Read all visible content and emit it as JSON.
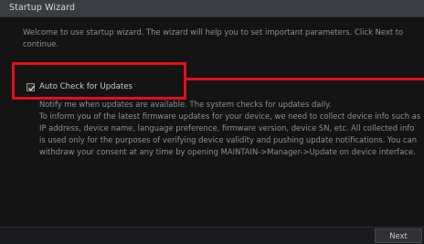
{
  "window": {
    "title": "Startup Wizard"
  },
  "intro": {
    "text": "Welcome to use startup wizard. The wizard will help you to set important parameters. Click Next to continue."
  },
  "auto_check": {
    "label": "Auto Check for Updates",
    "checked": true
  },
  "description": {
    "line1": "Notify me when updates are available. The system checks for updates daily.",
    "line2": "To inform you of the latest firmware updates for your device, we need to collect device info such as IP address, device name, language preference, firmware version, device SN, etc. All collected info is used only for the purposes of verifying device validity and pushing update notifications. You can withdraw your consent at any time by opening MAINTAIN->Manager->Update on device interface."
  },
  "footer": {
    "next_label": "Next"
  },
  "colors": {
    "highlight": "#e0101a",
    "titlebar": "#3a3c41",
    "background": "#141415"
  }
}
